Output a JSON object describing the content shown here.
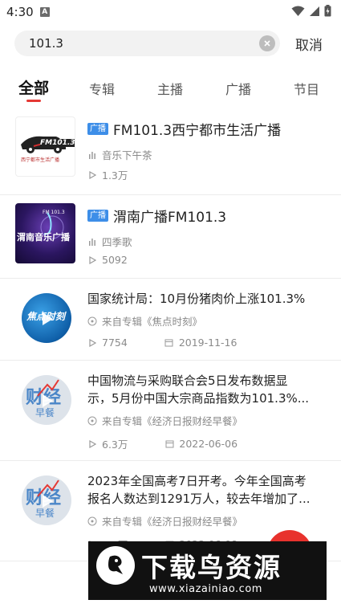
{
  "status_bar": {
    "time": "4:30",
    "notification_letter": "A"
  },
  "search": {
    "query": "101.3",
    "cancel_label": "取消"
  },
  "tabs": [
    {
      "label": "全部",
      "active": true
    },
    {
      "label": "专辑"
    },
    {
      "label": "主播"
    },
    {
      "label": "广播"
    },
    {
      "label": "节目"
    }
  ],
  "results": [
    {
      "tag": "广播",
      "title": "FM101.3西宁都市生活广播",
      "subtitle": "音乐下午茶",
      "plays": "1.3万",
      "cover_text": "FM101.3",
      "cover_subtext": "西宁都市生活广播"
    },
    {
      "tag": "广播",
      "title": "渭南广播FM101.3",
      "subtitle": "四季歌",
      "plays": "5092",
      "cover_text": "渭南音乐广播",
      "cover_subtext": "FM 101.3"
    },
    {
      "title_line1": "国家统计局：10月份猪肉价上涨101.3%",
      "album": "来自专辑《焦点时刻》",
      "plays": "7754",
      "date": "2019-11-16",
      "cover_text": "焦点时刻"
    },
    {
      "title_line1": "中国物流与采购联合会5日发布数据显",
      "title_line2": "示，5月份中国大宗商品指数为101.3%...",
      "album": "来自专辑《经济日报财经早餐》",
      "plays": "6.3万",
      "date": "2022-06-06",
      "cover_text": "财经",
      "cover_subtext": "早餐"
    },
    {
      "title_line1": "2023年全国高考7日开考。今年全国高考",
      "title_line2": "报名人数达到1291万人，较去年增加了...",
      "album": "来自专辑《经济日报财经早餐》",
      "plays": "5.4万",
      "date": "2023-06-08",
      "cover_text": "财经",
      "cover_subtext": "早餐"
    }
  ],
  "watermark": {
    "title": "下载鸟资源",
    "url": "www.xiazainiao.com"
  },
  "colors": {
    "accent": "#e53935",
    "tag_blue": "#3d8ee8"
  }
}
